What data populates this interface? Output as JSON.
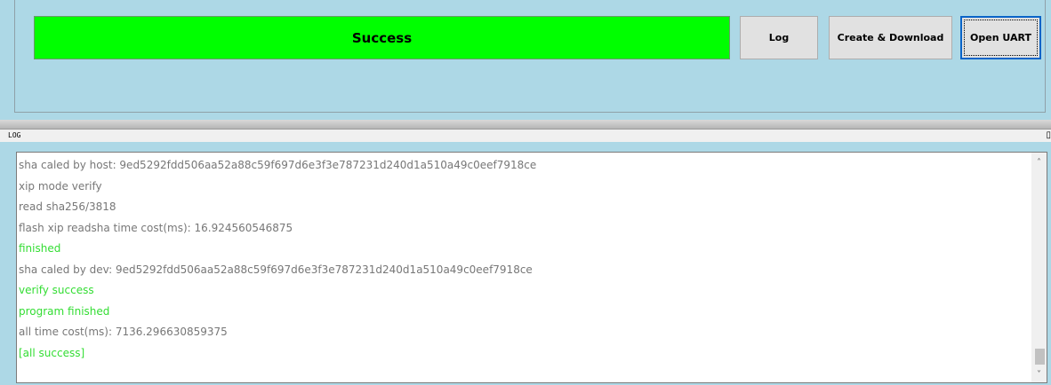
{
  "status": {
    "text": "Success",
    "color": "#00ff00"
  },
  "buttons": {
    "log": "Log",
    "create_download": "Create & Download",
    "open_uart": "Open UART"
  },
  "log_panel": {
    "title": "LOG",
    "corner_glyph": "▯",
    "lines": [
      {
        "text": "sha caled by host: 9ed5292fdd506aa52a88c59f697d6e3f3e787231d240d1a510a49c0eef7918ce",
        "status": "normal"
      },
      {
        "text": "xip mode verify",
        "status": "normal"
      },
      {
        "text": "read sha256/3818",
        "status": "normal"
      },
      {
        "text": "flash xip readsha time cost(ms): 16.924560546875",
        "status": "normal"
      },
      {
        "text": "finished",
        "status": "ok"
      },
      {
        "text": "sha caled by dev: 9ed5292fdd506aa52a88c59f697d6e3f3e787231d240d1a510a49c0eef7918ce",
        "status": "normal"
      },
      {
        "text": "verify success",
        "status": "ok"
      },
      {
        "text": "program finished",
        "status": "ok"
      },
      {
        "text": "all time cost(ms): 7136.296630859375",
        "status": "normal"
      },
      {
        "text": "[all success]",
        "status": "ok"
      }
    ],
    "scroll_up_glyph": "˄",
    "scroll_down_glyph": "˅"
  },
  "colors": {
    "background": "#add8e6",
    "log_normal": "#777777",
    "log_ok": "#33dd33"
  }
}
